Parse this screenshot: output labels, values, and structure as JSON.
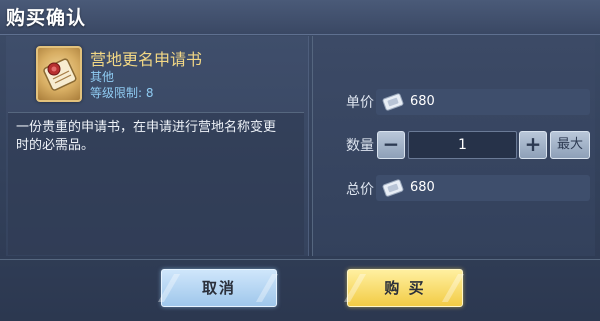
{
  "dialog": {
    "title": "购买确认"
  },
  "item": {
    "name": "营地更名申请书",
    "type": "其他",
    "level_limit": "等级限制: 8",
    "icon": "scroll-icon",
    "description": "一份贵重的申请书，在申请进行营地名称变更时的必需品。"
  },
  "purchase": {
    "unit_price_label": "单价",
    "unit_price": "680",
    "quantity_label": "数量",
    "quantity": "1",
    "minus_label": "−",
    "plus_label": "+",
    "max_label": "最大",
    "total_label": "总价",
    "total_price": "680",
    "currency_icon": "coupon-icon"
  },
  "buttons": {
    "cancel": "取消",
    "buy": "购 买"
  },
  "colors": {
    "item_name": "#f2d785",
    "item_meta": "#8fcbf2",
    "cancel_button": "#b7d8f4",
    "buy_button": "#f6d65c",
    "background": "#36445f"
  }
}
